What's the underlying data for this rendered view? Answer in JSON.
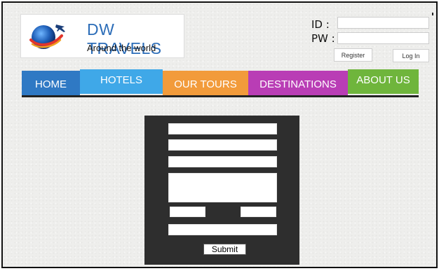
{
  "brand": {
    "title": "DW TRAVELS",
    "subtitle": "Around the world"
  },
  "login": {
    "id_label": "ID :",
    "pw_label": "PW :",
    "id_value": "",
    "pw_value": "",
    "register_label": "Register",
    "login_label": "Log In"
  },
  "nav": {
    "items": [
      {
        "label": "HOME",
        "color": "#2f79c4"
      },
      {
        "label": "HOTELS",
        "color": "#3fa8e8"
      },
      {
        "label": "OUR TOURS",
        "color": "#f29b3b"
      },
      {
        "label": "DESTINATIONS",
        "color": "#b93db5"
      },
      {
        "label": "ABOUT US",
        "color": "#6fb53c"
      }
    ]
  },
  "form": {
    "submit_label": "Submit"
  },
  "colors": {
    "brand_blue": "#2c6db8",
    "panel_dark": "#2e2e2e"
  },
  "icons": {
    "logo": "globe-airplane-icon"
  }
}
